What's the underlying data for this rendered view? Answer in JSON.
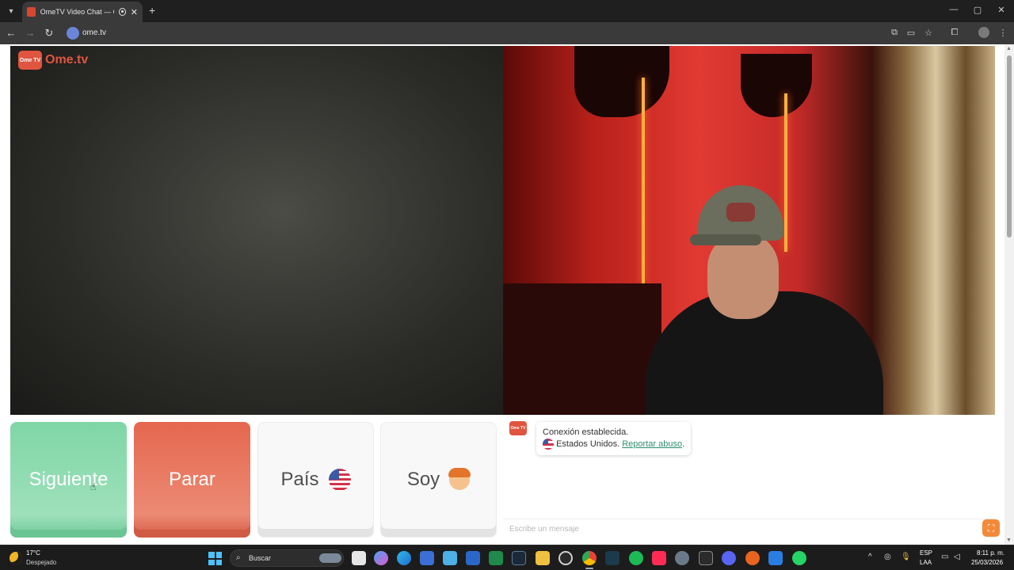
{
  "browser": {
    "tab_title": "OmeTV Video Chat — Ome",
    "tab_close": "✕",
    "new_tab": "+",
    "url": "ome.tv",
    "window_controls": {
      "minimize": "—",
      "maximize": "▢",
      "close": "✕"
    },
    "nav": {
      "back": "←",
      "forward": "→",
      "reload": "↻"
    },
    "toolbar_icons": [
      "translate-icon",
      "cast-icon",
      "bookmark-star-icon",
      "extensions-icon",
      "profile-avatar",
      "menu-icon"
    ],
    "toolbar_glyphs": {
      "translate": "⧉",
      "cast": "▭",
      "star": "☆",
      "extensions": "⧠",
      "menu": "⋮"
    }
  },
  "site": {
    "logo_tv_text": "Ome TV",
    "logo_text": "Ome.tv",
    "buttons": {
      "next": "Siguiente",
      "stop": "Parar",
      "country": "País",
      "gender": "Soy"
    },
    "chat": {
      "status": "Conexión establecida.",
      "country": "Estados Unidos.",
      "report_link": "Reportar abuso",
      "period": ".",
      "placeholder": "Escribe un mensaje",
      "logo_text": "Ome TV"
    }
  },
  "taskbar": {
    "weather_temp": "17°C",
    "weather_desc": "Despejado",
    "search_label": "Buscar",
    "search_glyph": "⌕",
    "lang_line1": "ESP",
    "lang_line2": "LAA",
    "time": "8:11 p. m.",
    "date": "25/03/2026",
    "tray_glyphs": {
      "overflow": "^",
      "network": "◎",
      "mic": "🎙",
      "wifi": "▭",
      "volume": "◁"
    }
  },
  "colors": {
    "next": "#7fd6a6",
    "stop": "#e5674f",
    "brand": "#e0553f",
    "link": "#2f8f6d",
    "send": "#f28a3a"
  }
}
